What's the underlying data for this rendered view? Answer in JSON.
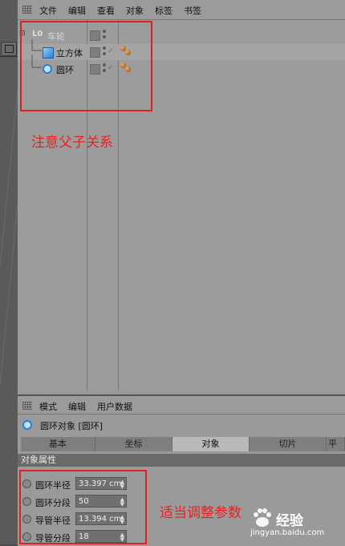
{
  "object_manager": {
    "menu": [
      "文件",
      "编辑",
      "查看",
      "对象",
      "标签",
      "书签"
    ],
    "objects": [
      {
        "name": "车轮",
        "icon": "null-object-icon",
        "null_icon_text": "L0"
      },
      {
        "name": "立方体",
        "icon": "cube-icon"
      },
      {
        "name": "圆环",
        "icon": "torus-icon"
      }
    ]
  },
  "annotations": {
    "hierarchy_note": "注意父子关系",
    "params_note": "适当调整参数"
  },
  "attribute_manager": {
    "menu": [
      "模式",
      "编辑",
      "用户数据"
    ],
    "object_title": "圆环对象 [圆环]",
    "tabs": [
      {
        "label": "基本",
        "active": false
      },
      {
        "label": "坐标",
        "active": false
      },
      {
        "label": "对象",
        "active": true
      },
      {
        "label": "切片",
        "active": false
      },
      {
        "label": "平滑",
        "active": false
      }
    ],
    "section_title": "对象属性",
    "properties": [
      {
        "label": "圆环半径",
        "value": "33.397 cm"
      },
      {
        "label": "圆环分段",
        "value": "50"
      },
      {
        "label": "导管半径",
        "value": "13.394 cm"
      },
      {
        "label": "导管分段",
        "value": "18"
      }
    ]
  },
  "watermark": {
    "brand": "经验",
    "url": "jingyan.baidu.com"
  },
  "colors": {
    "annotation_red": "#e82222",
    "panel_gray": "#9a9a9a",
    "active_tab": "#b9b9b9"
  }
}
